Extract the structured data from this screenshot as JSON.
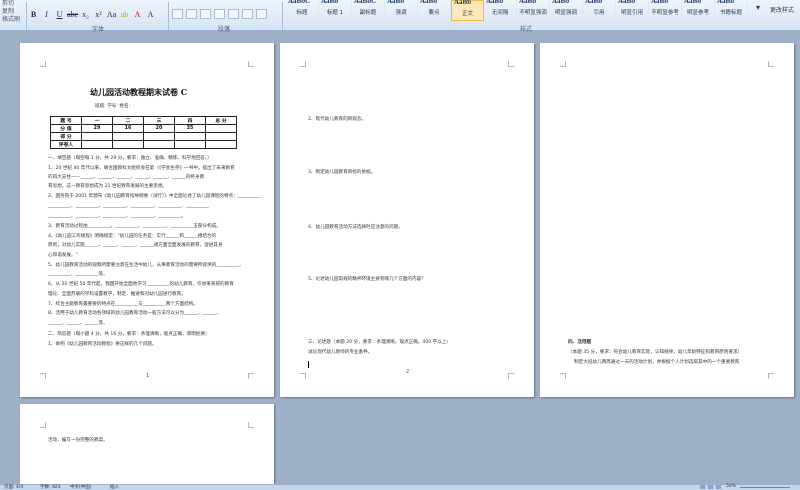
{
  "ribbon": {
    "clipboard": {
      "cut": "剪切",
      "copy": "复制",
      "format_painter": "格式刷"
    },
    "group_labels": {
      "font": "字体",
      "paragraph": "段落",
      "styles": "样式"
    },
    "font_buttons": [
      "B",
      "I",
      "U",
      "abe",
      "x₂",
      "x²",
      "Aa",
      "ab",
      "A",
      "A"
    ],
    "styles": [
      {
        "preview": "AaBbC",
        "name": "标题"
      },
      {
        "preview": "AaBb",
        "name": "标题 1"
      },
      {
        "preview": "AaBbC",
        "name": "副标题"
      },
      {
        "preview": "AaBb",
        "name": "强调"
      },
      {
        "preview": "AaBb",
        "name": "要点"
      },
      {
        "preview": "AaBb",
        "name": "正文"
      },
      {
        "preview": "AaBb",
        "name": "无间隔"
      },
      {
        "preview": "AaBb",
        "name": "不明显强调"
      },
      {
        "preview": "AaBb",
        "name": "明显强调"
      },
      {
        "preview": "AaBb",
        "name": "引用"
      },
      {
        "preview": "AaBb",
        "name": "明显引用"
      },
      {
        "preview": "AaBb",
        "name": "不明显参考"
      },
      {
        "preview": "AaBb",
        "name": "明显参考"
      },
      {
        "preview": "AaBb",
        "name": "书籍标题"
      }
    ],
    "active_style_index": 5,
    "change_styles": "更改样式"
  },
  "page1": {
    "title": "幼儿园活动教程期末试卷 C",
    "info": "班级:                学号:                姓名:",
    "table": {
      "rows": [
        [
          "题 号",
          "一",
          "二",
          "三",
          "四",
          "总 分"
        ],
        [
          "分 值",
          "29",
          "16",
          "20",
          "35",
          ""
        ],
        [
          "得 分",
          "",
          "",
          "",
          "",
          ""
        ],
        [
          "评卷人",
          "",
          "",
          "",
          "",
          ""
        ]
      ]
    },
    "lines": [
      "一、填空题（每空每 1 分，共 29 分。要求：独立、准确、精炼、科学地回答。）",
      "1、20 世纪 40 年代以来，联合国教科文组织会在第（《学会生存》一书中，提出了未来教育",
      "的四大支柱——______、______、______、______、______、______的终身教",
      "育思想，这一教育思想成为 21 世纪教育发展的主要思想。",
      "2、国务院于 2001 年颁布《幼儿园教育指导纲要（试行）》中全面论述了幼儿园课程的特点：__________",
      "__________、__________、__________、__________、__________、__________",
      "__________、__________、__________、__________、__________。",
      "3、教育活动过程由__________、__________、__________、__________五部分构成。",
      "4、《幼儿园工作规程》明确规定：\"幼儿园的任务是：实行______和______相结合的",
      "原则，对幼儿实施______、______、______、______诸方面全面发展的教育，促进其身",
      "心和谐发展。\"",
      "5、幼儿园教育活动的观察所需要注意在生活中幼儿，从事教育活动的需要所提供的__________、",
      "__________、__________等。",
      "6、从 20 世纪 50 年代起，我国开始全面地学习__________的幼儿教育，引进来系统的教育",
      "理论、全面苏联的学科设置教学，制定、推进和对幼儿园进行教育。",
      "7、综合主题教育最重要的特点在__________与__________两个方面结构。",
      "8、活用于幼儿教育活动各领域的幼儿园教育活动一般方法可以分为______、______、",
      "______、______、______等。",
      "二、简答题（每小题 4 分，共 16 分。要求：条理清晰，观点正确，简明扼要）",
      "1、举例《幼儿园教育活动教程》要这样的几个问题。"
    ],
    "page_marker": "1"
  },
  "page2": {
    "lines": [
      "2、现代幼儿教育的新观念。",
      "3、制定幼儿园教育目标的依据。",
      "4、幼儿园教育活动方法选择时应注意的问题。",
      "5、论述幼儿园常规的精神环境主要有哪几个方面的内容？",
      "三、论述题（本题 20 分，要求：条理清晰，观点正确，400 字以上）",
      "试论现代幼儿教师的专业素养。"
    ],
    "page_marker": "2"
  },
  "page3": {
    "lines": [
      "四、活用题",
      "（本题 35 分，要求：符合幼儿教育实际，认知规律，幼儿年龄特征和教育原则要求）",
      "制定大班幼儿两周通过一天的活动计划，并根据个人计划选取其中的一个重要教育"
    ]
  },
  "page4": {
    "lines": [
      "活动，编写一份完整的教案。"
    ]
  },
  "status_bar": {
    "page": "页面: 4/4",
    "words": "字数: 923",
    "lang": "中文(中国)",
    "mode": "插入",
    "zoom": "50%"
  }
}
